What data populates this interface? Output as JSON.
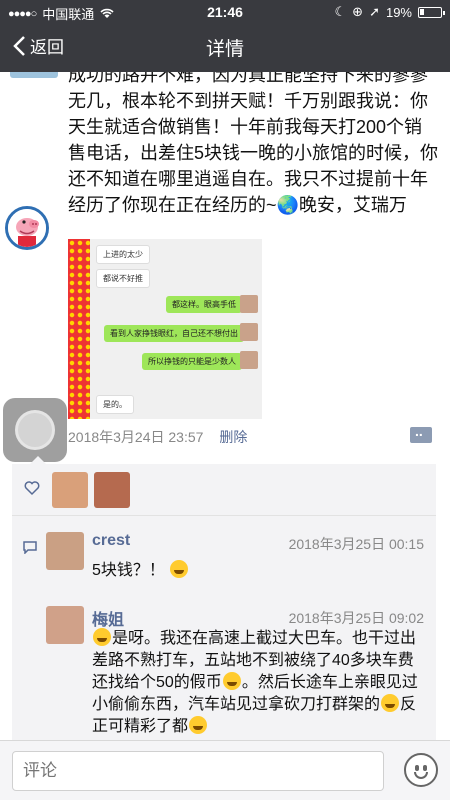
{
  "status_bar": {
    "carrier": "中国联通",
    "time": "21:46",
    "battery": "19%"
  },
  "nav": {
    "back_label": "返回",
    "title": "详情"
  },
  "post": {
    "text": "成功的路并不难，因为真正能坚持下来的寥寥无几，根本轮不到拼天赋！千万别跟我说：你天生就适合做销售！十年前我每天打200个销售电话，出差住5块钱一晚的小旅馆的时候，你还不知道在哪里逍遥自在。我只不过提前十年经历了你现在正在经历的~🌏晚安，艾瑞万",
    "screenshot_messages": [
      {
        "side": "left",
        "text": "上进的太少"
      },
      {
        "side": "left",
        "text": "都说不好推"
      },
      {
        "side": "right",
        "text": "都这样。眼高手低"
      },
      {
        "side": "right",
        "text": "看到人家挣钱眼红，自己还不想付出"
      },
      {
        "side": "right",
        "text": "所以挣钱的只能是少数人"
      },
      {
        "side": "left",
        "text": "是的。"
      }
    ],
    "date": "2018年3月24日 23:57",
    "delete_label": "删除"
  },
  "comments": [
    {
      "name": "crest",
      "time": "2018年3月25日 00:15",
      "text": "5块钱？！"
    },
    {
      "name": "梅姐",
      "time": "2018年3月25日 09:02",
      "text_parts": [
        "是呀。我还在高速上截过大巴车。也干过出差路不熟打车，五站地不到被绕了40多块车费还找给个50的假币",
        "。然后长途车上亲眼见过小偷偷东西，汽车站见过拿砍刀打群架的",
        "反正可精彩了都"
      ]
    }
  ],
  "input": {
    "placeholder": "评论"
  },
  "colors": {
    "nav_bg": "#393a3f",
    "link": "#576b95",
    "bubble_green": "#9ee659"
  }
}
